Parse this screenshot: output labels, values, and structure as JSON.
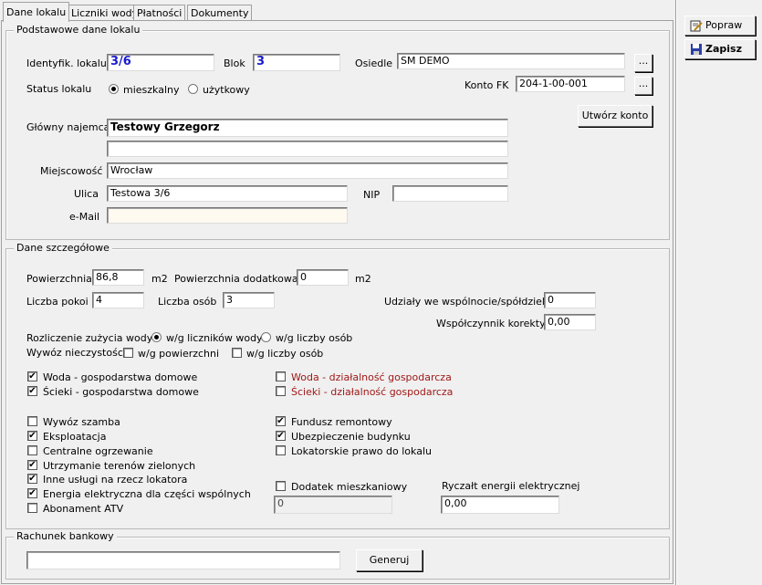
{
  "tabs": [
    "Dane lokalu",
    "Liczniki wody",
    "Płatności",
    "Dokumenty"
  ],
  "toolbar": {
    "popraw_label": "Popraw",
    "zapisz_label": "Zapisz"
  },
  "basic": {
    "legend": "Podstawowe dane lokalu",
    "ident_label": "Identyfik. lokalu",
    "ident_value": "3/6",
    "blok_label": "Blok",
    "blok_value": "3",
    "osiedle_label": "Osiedle",
    "osiedle_value": "SM DEMO",
    "browse_label": "...",
    "status_label": "Status lokalu",
    "status_options": [
      "mieszkalny",
      "użytkowy"
    ],
    "status_selected": "mieszkalny",
    "konto_label": "Konto FK",
    "konto_value": "204-1-00-001",
    "create_account_label": "Utwórz konto",
    "najemca_label": "Główny najemca",
    "najemca_value": "Testowy Grzegorz",
    "najemca2_value": "",
    "miejscowosc_label": "Miejscowość",
    "miejscowosc_value": "Wrocław",
    "ulica_label": "Ulica",
    "ulica_value": "Testowa 3/6",
    "nip_label": "NIP",
    "nip_value": "",
    "email_label": "e-Mail",
    "email_value": ""
  },
  "details": {
    "legend": "Dane szczegółowe",
    "powierzchnia_label": "Powierzchnia",
    "powierzchnia_value": "86,8",
    "m2": "m2",
    "pow_dod_label": "Powierzchnia dodatkowa",
    "pow_dod_value": "0",
    "pokoje_label": "Liczba pokoi",
    "pokoje_value": "4",
    "osoby_label": "Liczba osób",
    "osoby_value": "3",
    "udzialy_label": "Udziały we wspólnocie/spółdzielni",
    "udzialy_value": "0",
    "wspolczynnik_label": "Współczynnik korekty",
    "wspolczynnik_value": "0,00",
    "rozliczenie_label": "Rozliczenie zużycia wody",
    "rozliczenie_options": [
      "w/g liczników wody",
      "w/g liczby osób"
    ],
    "rozliczenie_selected": "w/g liczników wody",
    "wywoz_label": "Wywóz nieczystości",
    "wywoz_options": [
      {
        "label": "w/g powierzchni",
        "checked": false
      },
      {
        "label": "w/g liczby osób",
        "checked": false
      }
    ],
    "checks_left": [
      {
        "label": "Woda - gospodarstwa domowe",
        "checked": true
      },
      {
        "label": "Ścieki - gospodarstwa domowe",
        "checked": true
      },
      {
        "label": "Wywóz szamba",
        "checked": false
      },
      {
        "label": "Eksploatacja",
        "checked": true
      },
      {
        "label": "Centralne ogrzewanie",
        "checked": false
      },
      {
        "label": "Utrzymanie terenów zielonych",
        "checked": true
      },
      {
        "label": "Inne usługi na rzecz lokatora",
        "checked": true
      },
      {
        "label": "Energia elektryczna dla części wspólnych",
        "checked": true
      },
      {
        "label": "Abonament ATV",
        "checked": false
      }
    ],
    "checks_right": [
      {
        "label": "Woda - działalność gospodarcza",
        "checked": false
      },
      {
        "label": "Ścieki - działalność gospodarcza",
        "checked": false
      },
      {
        "label": "Fundusz remontowy",
        "checked": true
      },
      {
        "label": "Ubezpieczenie budynku",
        "checked": true
      },
      {
        "label": "Lokatorskie prawo do lokalu",
        "checked": false
      }
    ],
    "dodatek_label": "Dodatek mieszkaniowy",
    "dodatek_checked": false,
    "dodatek_value": "0",
    "ryczalt_label": "Ryczałt energii elektrycznej",
    "ryczalt_value": "0,00",
    "business_color": "#a01818"
  },
  "bank": {
    "legend": "Rachunek bankowy",
    "account_value": "",
    "generate_label": "Generuj"
  }
}
